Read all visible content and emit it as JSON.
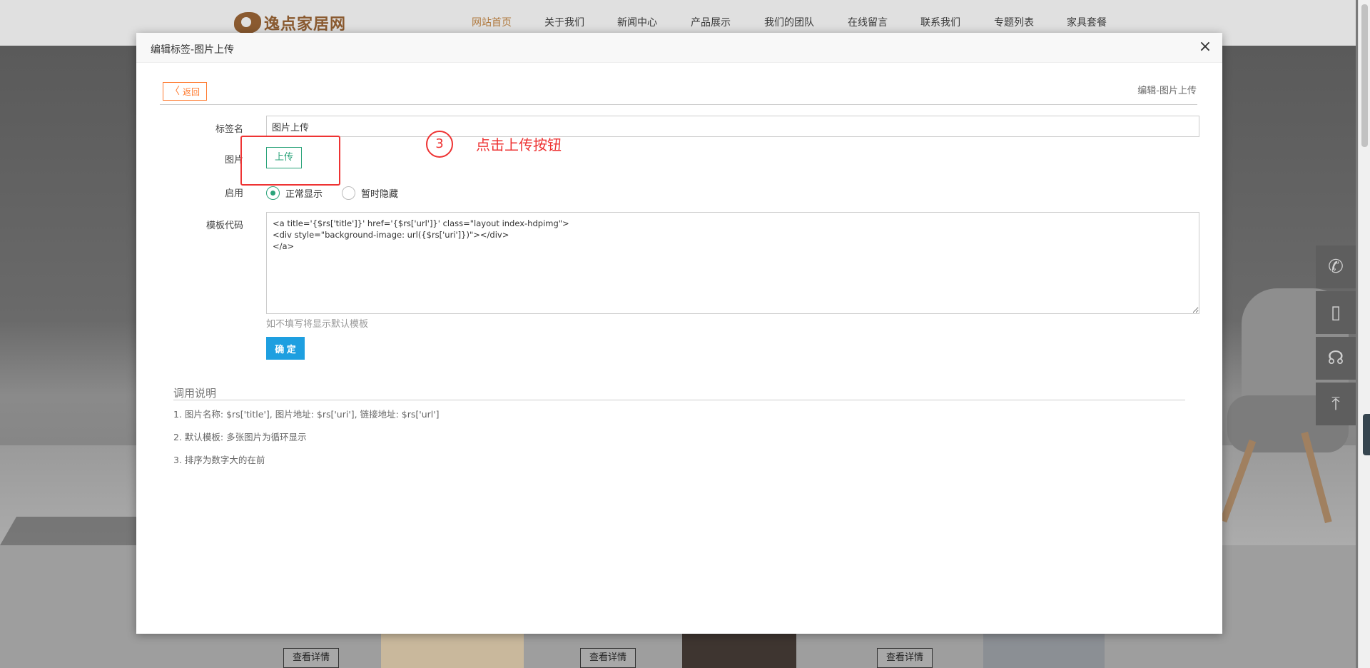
{
  "site": {
    "logo_text": "逸点家居网",
    "nav": [
      {
        "label": "网站首页",
        "active": true
      },
      {
        "label": "关于我们"
      },
      {
        "label": "新闻中心"
      },
      {
        "label": "产品展示"
      },
      {
        "label": "我们的团队"
      },
      {
        "label": "在线留言"
      },
      {
        "label": "联系我们"
      },
      {
        "label": "专题列表"
      },
      {
        "label": "家具套餐"
      }
    ],
    "detail_button_label": "查看详情",
    "side_tools": [
      {
        "icon": "phone-icon",
        "glyph": "✆"
      },
      {
        "icon": "mobile-icon",
        "glyph": "▯"
      },
      {
        "icon": "headset-icon",
        "glyph": "☊"
      },
      {
        "icon": "back-to-top-icon",
        "glyph": "⤒"
      }
    ]
  },
  "modal": {
    "title": "编辑标签-图片上传",
    "close_glyph": "×",
    "back_label": "返回",
    "back_chevron": "〈",
    "subtitle": "编辑-图片上传",
    "form": {
      "name_label": "标签名",
      "name_value": "图片上传",
      "image_label": "图片",
      "upload_label": "上传",
      "enable_label": "启用",
      "radio_options": [
        {
          "label": "正常显示",
          "checked": true
        },
        {
          "label": "暂时隐藏",
          "checked": false
        }
      ],
      "template_label": "模板代码",
      "template_value": "<a title='{$rs['title']}' href='{$rs['url']}' class=\"layout index-hdpimg\">\n<div style=\"background-image: url({$rs['uri']})\"></div>\n</a>",
      "hint": "如不填写将显示默认模板",
      "confirm_label": "确 定"
    },
    "annotation": {
      "step_number": "3",
      "step_text": "点击上传按钮",
      "color": "#e33333"
    },
    "help": {
      "title": "调用说明",
      "lines": [
        "1. 图片名称:   $rs['title'], 图片地址:   $rs['uri'], 链接地址:   $rs['url']",
        "2. 默认模板:   多张图片为循环显示",
        "3. 排序为数字大的在前"
      ]
    }
  },
  "colors": {
    "accent_green": "#2aa37a",
    "primary_blue": "#1e9fe0",
    "back_orange": "#ff7a2f",
    "logo_brown": "#8a5a30"
  }
}
